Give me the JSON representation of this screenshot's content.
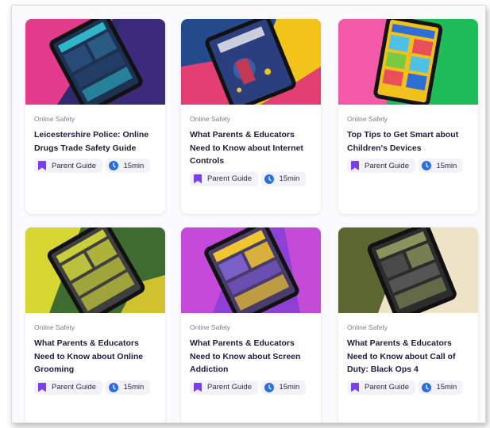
{
  "cards": [
    {
      "category": "Online Safety",
      "title": "Leicestershire Police: Online Drugs Trade Safety Guide",
      "type_label": "Parent Guide",
      "duration": "15min",
      "colors": [
        "#e23b8c",
        "#2a2568",
        "#3c2a7c"
      ],
      "icon": "tablet-illustration"
    },
    {
      "category": "Online Safety",
      "title": "What Parents & Educators Need to Know about Internet Controls",
      "type_label": "Parent Guide",
      "duration": "15min",
      "colors": [
        "#f2c318",
        "#e43f73",
        "#254a8c"
      ],
      "icon": "tablet-illustration"
    },
    {
      "category": "Online Safety",
      "title": "Top Tips to Get Smart about Children's Devices",
      "type_label": "Parent Guide",
      "duration": "15min",
      "colors": [
        "#f25aa8",
        "#1fbd5a",
        "#f2c01b"
      ],
      "icon": "tablet-illustration"
    },
    {
      "category": "Online Safety",
      "title": "What Parents & Educators Need to Know about Online Grooming",
      "type_label": "Parent Guide",
      "duration": "15min",
      "colors": [
        "#d8d631",
        "#3e6b30",
        "#d0c12e"
      ],
      "icon": "tablet-illustration"
    },
    {
      "category": "Online Safety",
      "title": "What Parents & Educators Need to Know about Screen Addiction",
      "type_label": "Parent Guide",
      "duration": "15min",
      "colors": [
        "#c64ad9",
        "#8e3fd6",
        "#c34bd6"
      ],
      "icon": "tablet-illustration"
    },
    {
      "category": "Online Safety",
      "title": "What Parents & Educators Need to Know about Call of Duty: Black Ops 4",
      "type_label": "Parent Guide",
      "duration": "15min",
      "colors": [
        "#5b6630",
        "#ede3c6",
        "#8a935c"
      ],
      "icon": "tablet-illustration"
    }
  ],
  "icons": {
    "type": "bookmark-icon",
    "duration": "clock-icon"
  },
  "accent": "#7b3ff2",
  "clock_color": "#2a6fe0"
}
